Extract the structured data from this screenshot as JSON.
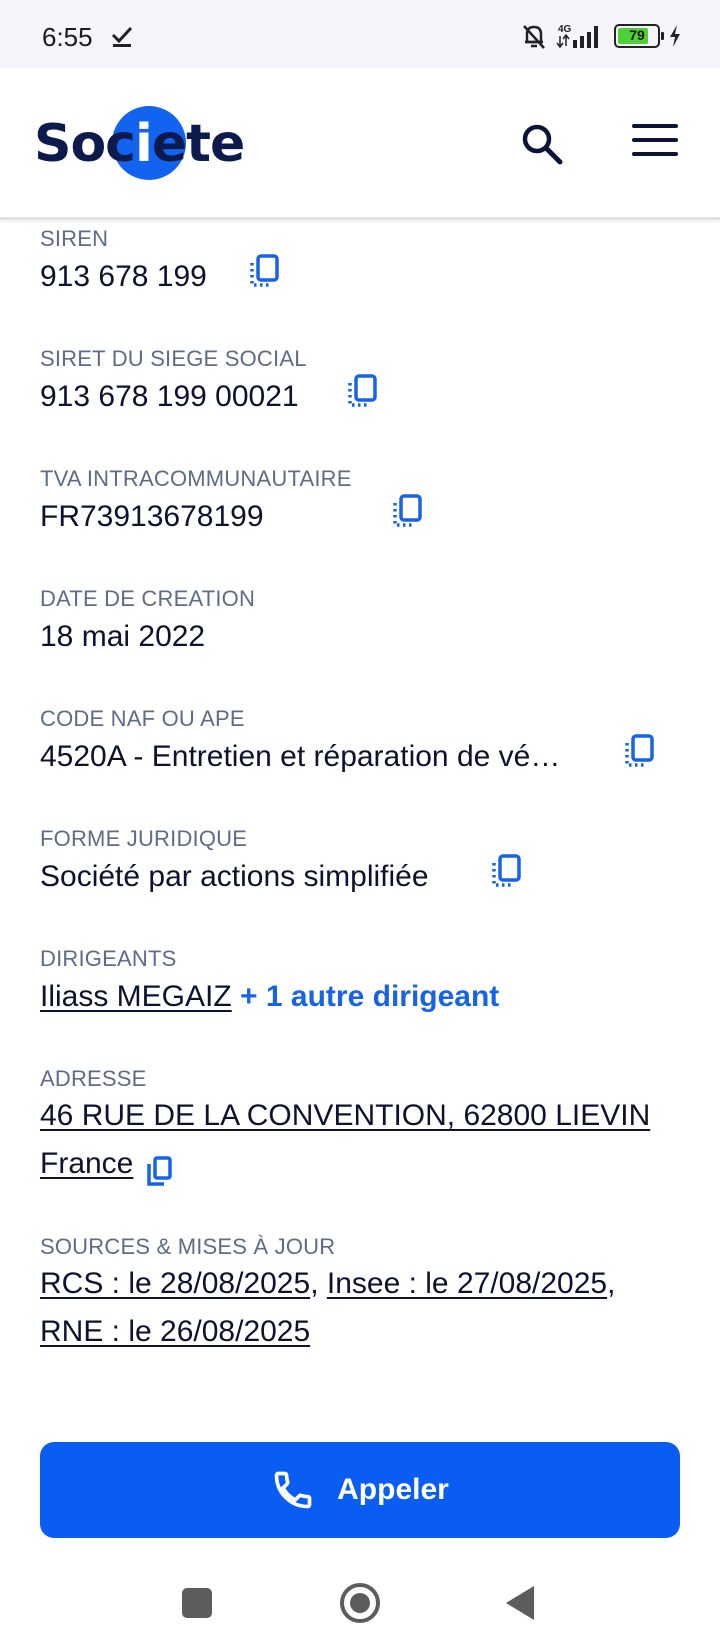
{
  "status_bar": {
    "time": "6:55",
    "network": "4G",
    "battery": "79"
  },
  "header": {
    "logo_text_before": "Soc",
    "logo_text_i": "i",
    "logo_text_after": "ete",
    "search_icon": "search-icon",
    "menu_icon": "hamburger-menu-icon"
  },
  "fields": {
    "siren": {
      "label": "SIREN",
      "value": "913 678 199"
    },
    "siret": {
      "label": "SIRET DU SIEGE SOCIAL",
      "value": "913 678 199 00021"
    },
    "tva": {
      "label": "TVA INTRACOMMUNAUTAIRE",
      "value": "FR73913678199"
    },
    "creation": {
      "label": "DATE DE CREATION",
      "value": "18 mai 2022"
    },
    "naf": {
      "label": "CODE NAF OU APE",
      "value": "4520A - Entretien et réparation de vé…"
    },
    "forme": {
      "label": "FORME JURIDIQUE",
      "value": "Société par actions simplifiée"
    },
    "dirigeants": {
      "label": "DIRIGEANTS",
      "name": "Iliass MEGAIZ",
      "more": "+ 1 autre dirigeant"
    },
    "adresse": {
      "label": "ADRESSE",
      "line1": "46 RUE DE LA CONVENTION, 62800 LIEVIN",
      "line2": "France"
    },
    "sources": {
      "label": "SOURCES & MISES À JOUR",
      "rcs": "RCS : le 28/08/2025",
      "sep1": ", ",
      "insee": "Insee : le 27/08/2025",
      "sep2": ",",
      "rne": "RNE : le 26/08/2025"
    }
  },
  "call_button": {
    "label": "Appeler",
    "icon": "phone-icon"
  },
  "colors": {
    "accent": "#0a5df2",
    "text": "#0d1230",
    "label": "#5f6b87",
    "link_blue": "#1763e8"
  }
}
